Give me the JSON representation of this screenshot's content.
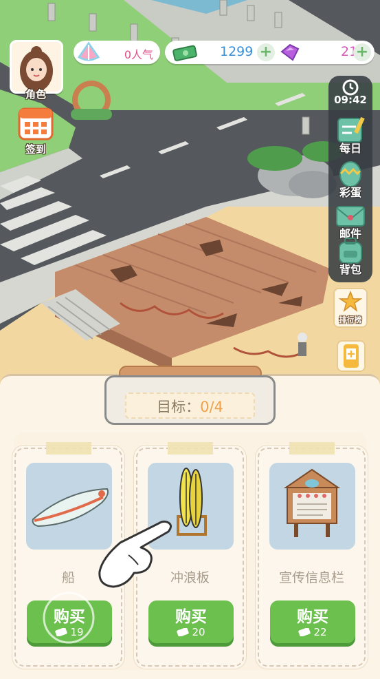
{
  "hud": {
    "character_label": "角色",
    "checkin_label": "签到",
    "popularity": "0人气",
    "cash": "1299",
    "gems": "21",
    "clock": "09:42"
  },
  "side_menu": [
    {
      "label": "每日",
      "icon": "daily-icon"
    },
    {
      "label": "彩蛋",
      "icon": "easter-egg-icon"
    },
    {
      "label": "邮件",
      "icon": "mail-icon"
    },
    {
      "label": "背包",
      "icon": "backpack-icon"
    }
  ],
  "ranking_label": "排行榜",
  "goal": {
    "label": "目标：",
    "value": "0/4"
  },
  "items": [
    {
      "name": "船",
      "buy_label": "购买",
      "price": "19"
    },
    {
      "name": "冲浪板",
      "buy_label": "购买",
      "price": "20"
    },
    {
      "name": "宣传信息栏",
      "buy_label": "购买",
      "price": "22"
    }
  ],
  "colors": {
    "buy_green": "#6cc04e",
    "goal_orange": "#f0a14a",
    "cash_blue": "#3a8fd6",
    "gem_pink": "#d958b8"
  }
}
